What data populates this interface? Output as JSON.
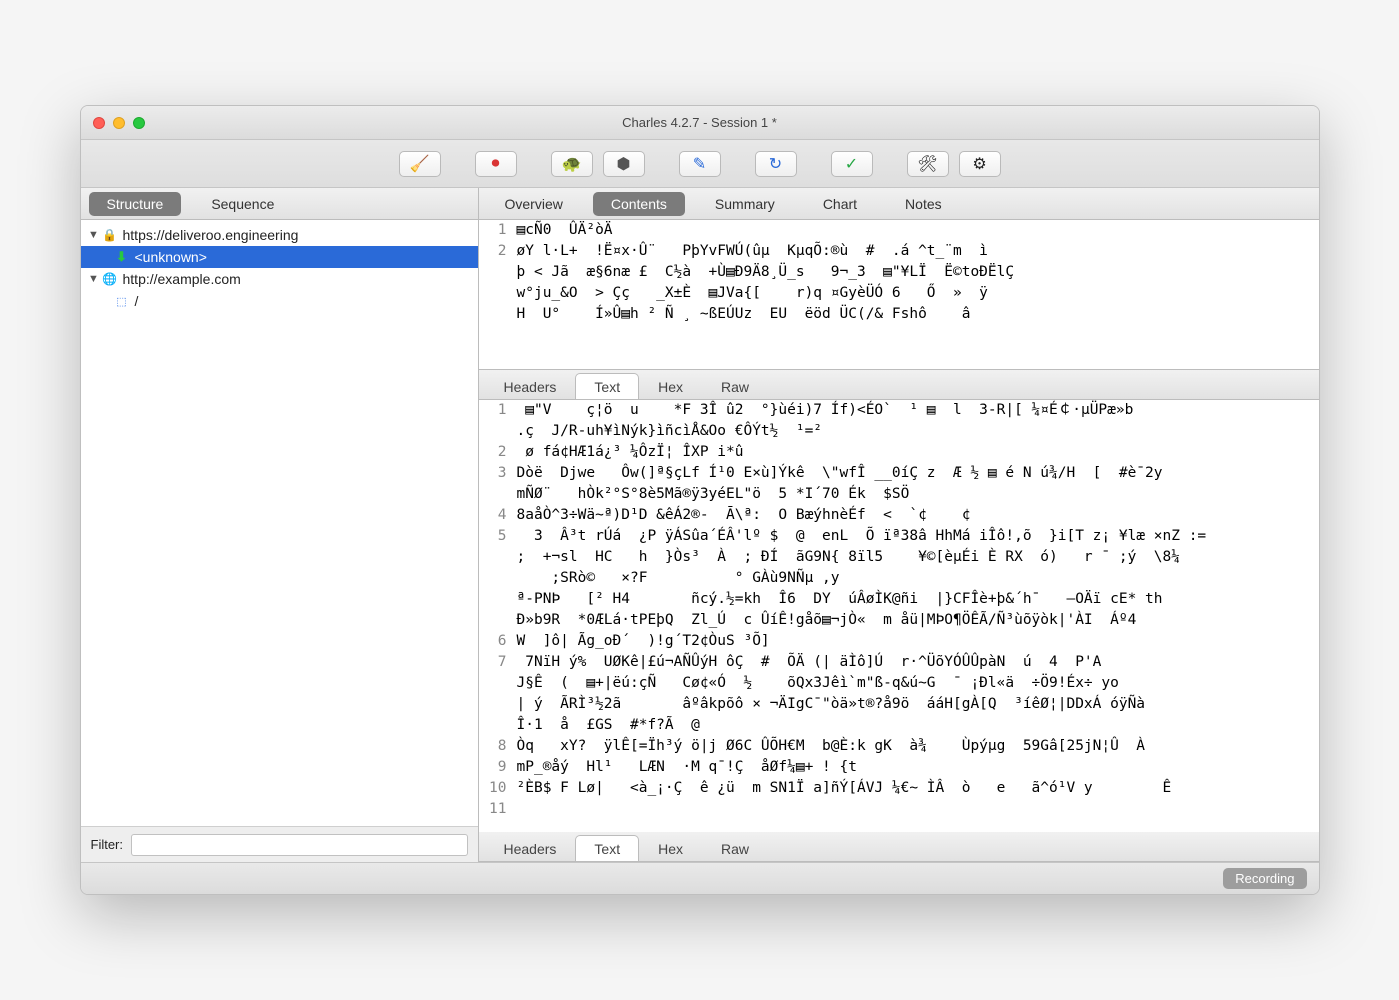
{
  "window": {
    "title": "Charles 4.2.7 - Session 1 *"
  },
  "toolbar": {
    "items": [
      {
        "name": "brush",
        "glyph": "🧹"
      },
      {
        "name": "record",
        "glyph": "⏺",
        "color": "#d93434"
      },
      {
        "name": "throttle",
        "glyph": "🐢"
      },
      {
        "name": "breakpoints",
        "glyph": "⬢",
        "color": "#555"
      },
      {
        "name": "compose",
        "glyph": "✎",
        "color": "#2a6ad8"
      },
      {
        "name": "repeat",
        "glyph": "↻",
        "color": "#2a6ad8"
      },
      {
        "name": "validate",
        "glyph": "✓",
        "color": "#28a745"
      },
      {
        "name": "tools",
        "glyph": "🛠"
      },
      {
        "name": "settings",
        "glyph": "⚙"
      }
    ]
  },
  "left_tabs": {
    "items": [
      "Structure",
      "Sequence"
    ],
    "selected": 0
  },
  "tree": [
    {
      "kind": "host",
      "icon": "lock",
      "label": "https://deliveroo.engineering",
      "expanded": true
    },
    {
      "kind": "child",
      "icon": "down",
      "label": "<unknown>",
      "selected": true
    },
    {
      "kind": "host",
      "icon": "globe",
      "label": "http://example.com",
      "expanded": true
    },
    {
      "kind": "child",
      "icon": "page",
      "label": "/"
    }
  ],
  "filter": {
    "label": "Filter:",
    "value": ""
  },
  "right_tabs": {
    "items": [
      "Overview",
      "Contents",
      "Summary",
      "Chart",
      "Notes"
    ],
    "selected": 1
  },
  "top_pane": {
    "lines": [
      {
        "n": "1",
        "t": "▤cÑ0  ÛÄ²òÄ"
      },
      {
        "n": "2",
        "t": "øY l·L+  !Ë¤x·Û¨   PþYvFWÚ(ûµ  KµqÕ:®ù  #  .á ^t_¨m  ì"
      },
      {
        "n": "",
        "t": "þ < Jã  æ§6næ £  C½à  +Ù▤Ð9Ä8¸Ü_s   9¬_3  ▤\"¥LÏ  Ë©toÐËlÇ"
      },
      {
        "n": "",
        "t": "w°ju_&O  > Çç   _X±È  ▤JVa{[    r)q ¤GyèÜÓ 6   Ő  »  ÿ"
      },
      {
        "n": "",
        "t": "H  U°    Í»Û▤h ² Ñ ¸ ~ßEÚUz  EU  ëöd ÜC(/& Fshô    â"
      }
    ]
  },
  "subtabs": {
    "items": [
      "Headers",
      "Text",
      "Hex",
      "Raw"
    ],
    "selected": 1
  },
  "mid_pane": {
    "lines": [
      {
        "n": "1",
        "t": " ▤\"V    ç¦ö  u    *F 3Î û2  °}ùéi)7 Íf)<ÉO`  ¹ ▤  l  3-R|[ ¼¤É￠·µÜPæ»b"
      },
      {
        "n": "",
        "t": ".ç  J/R-uh¥ìNýk}ìñcìÅ&Oo €ÔÝt½  ¹=²"
      },
      {
        "n": "2",
        "t": " ø fá¢HÆ1á¿³ ¼ÔzÏ¦ ÎXP i*û"
      },
      {
        "n": "3",
        "t": "Dòë  Djwe   Ôw(]ª§çLf Í¹0 E×ù]Ýkê  \\\"wfÎ __0íÇ z  Æ ½ ▤ é N ú¾/H  [  #è¯2y"
      },
      {
        "n": "",
        "t": "mÑØ¨   hÒk²°S°8è5Mã®ÿ3yéEL\"ö  5 *I´70 Ék  $SÖ"
      },
      {
        "n": "4",
        "t": "8aåÒ^3÷Wä~ª)D¹D &êÁ2®-  Ā\\ª:  O BæýhnèÉf  <  `¢    ¢"
      },
      {
        "n": "5",
        "t": "  3  Â³t rÚá  ¿P ÿÁSûa´ÉÂ'lº $  @  enL  Õ ïª38â HhMá iÎô!,õ  }i[T z¡ ¥læ ×nZ :="
      },
      {
        "n": "",
        "t": ";  +¬sl  HC   h  }Òs³  À  ; ÐÍ  ãG9N{ 8ïl5    ¥©[èµÉi È RX  ó)   r ¯ ;ý  \\8¼"
      },
      {
        "n": "",
        "t": "    ;SRò©   ×?F          ° GÀù9NÑµ ,y"
      },
      {
        "n": "",
        "t": "ª-PNÞ   [² H4       ñcý.½=kh  Î6  DY  úÂøÌK@ñi  |}CFÎè+þ&´h¯   –OÄï cE* th"
      },
      {
        "n": "",
        "t": "Ð»b9R  *0ÆLá·tPEþQ  Zl_Ú  c ÛíÊ!gåõ▤¬jÒ«  m åü|MÞO¶ÖÊÃ/Ñ³ùõÿòk|'ÀI  Áº4"
      },
      {
        "n": "6",
        "t": "W  ]ô| Ãg_oĐ´  )!g´T2¢ÒuS ³Õ]"
      },
      {
        "n": "7",
        "t": " 7NïH ý%  UØKê|£ú¬AÑÛýH ôÇ  #  ÕÄ (| äÌô]Ú  r·^ÜõYÓÛÛpàN  ú  4  P'A"
      },
      {
        "n": "",
        "t": "J§Ê  (  ▤+|ëú:çÑ   Cø¢«Ó  ½    õQx3Jêì`m\"ß-q&ú~G  ¯ ¡Ðl«ä  ÷Ö9!Éx÷ yo"
      },
      {
        "n": "",
        "t": "| ý  ÃRÌ³½2ã       âºâkpõô × ¬ÄIgC¯\"òä»t®?å9ö  ááH[gÀ[Q  ³íêØ¦|DDxÁ óÿÑà"
      },
      {
        "n": "",
        "t": "Î·1  å  £GS  #*f?Ã  @"
      },
      {
        "n": "8",
        "t": "Òq   xY?  ÿlÊ[=Ïh³ý ö|j Ø6C ÛÕH€M  b@È:k gK  à¾    Ùpýµg  59Gâ[25jN¦Û  À"
      },
      {
        "n": "9",
        "t": "mP_®åý  Hl¹   LÆN  ·M q¯!Ç  åØf¼▤+ ! {t"
      },
      {
        "n": "10",
        "t": "²ÈB$ F Lø|   <à_¡·Ç  ê ¿ü  m SN1Ï a]ñÝ[ÁVJ ¼€~ ÌÂ  ò   e   ã^ó¹V y        Ê"
      },
      {
        "n": "11",
        "t": ""
      }
    ]
  },
  "bottom_subtabs": {
    "items": [
      "Headers",
      "Text",
      "Hex",
      "Raw"
    ],
    "selected": 1
  },
  "status": {
    "label": "Recording"
  }
}
